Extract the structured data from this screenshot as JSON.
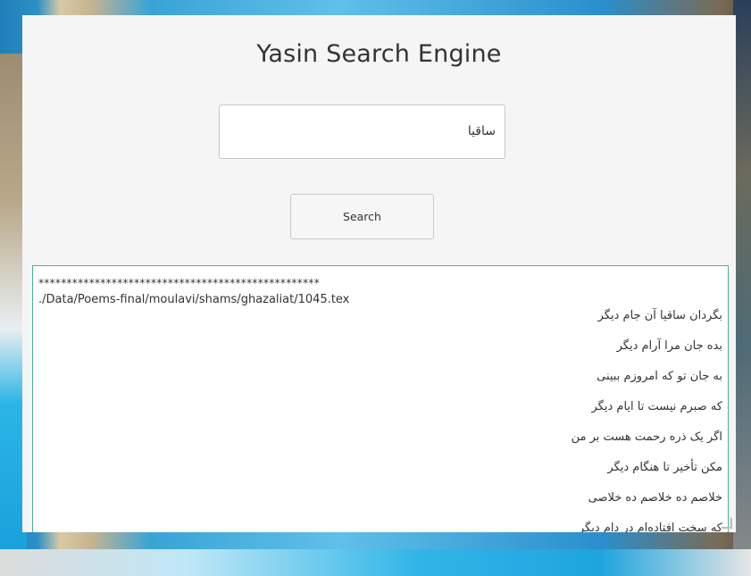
{
  "app": {
    "title": "Yasin Search Engine"
  },
  "search": {
    "value": "ساقیا",
    "button_label": "Search"
  },
  "results": {
    "separator": "**************************************************",
    "path": "./Data/Poems-final/moulavi/shams/ghazaliat/1045.tex",
    "verses": [
      "بگردان ساقیا آن جام دیگر",
      "بده جان مرا آرام دیگر",
      "به جان تو که امروزم ببینی",
      "که صبرم نیست تا ایام دیگر",
      "اگر یک ذره رحمت هست بر من",
      "مکن تأخیر تا هنگام دیگر",
      "خلاصم ده خلاصم ده خلاصی",
      "که سخت افتاده‌ام در دام دیگر"
    ]
  }
}
